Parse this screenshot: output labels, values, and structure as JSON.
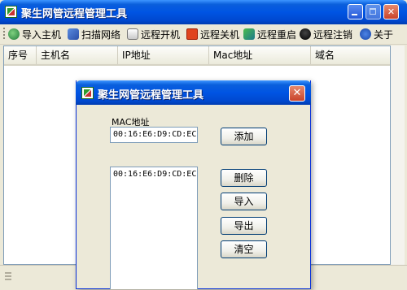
{
  "window": {
    "title": "聚生网管远程管理工具"
  },
  "toolbar": {
    "items": [
      {
        "label": "导入主机",
        "icon": "import-host-icon"
      },
      {
        "label": "扫描网络",
        "icon": "scan-network-icon"
      },
      {
        "label": "远程开机",
        "icon": "remote-start-icon"
      },
      {
        "label": "远程关机",
        "icon": "remote-shutdown-icon"
      },
      {
        "label": "远程重启",
        "icon": "remote-restart-icon"
      },
      {
        "label": "远程注销",
        "icon": "remote-logoff-icon"
      },
      {
        "label": "关于",
        "icon": "about-icon"
      }
    ]
  },
  "list": {
    "columns": [
      "序号",
      "主机名",
      "IP地址",
      "Mac地址",
      "域名"
    ]
  },
  "dialog": {
    "title": "聚生网管远程管理工具",
    "mac_label": "MAC地址",
    "mac_input_value": "00:16:E6:D9:CD:EC",
    "mac_list": [
      "00:16:E6:D9:CD:EC"
    ],
    "buttons": {
      "add": "添加",
      "delete": "删除",
      "import": "导入",
      "export": "导出",
      "clear": "清空"
    }
  },
  "colors": {
    "titlebar": "#0054e3",
    "face": "#ece9d8",
    "border": "#7f9db9"
  }
}
